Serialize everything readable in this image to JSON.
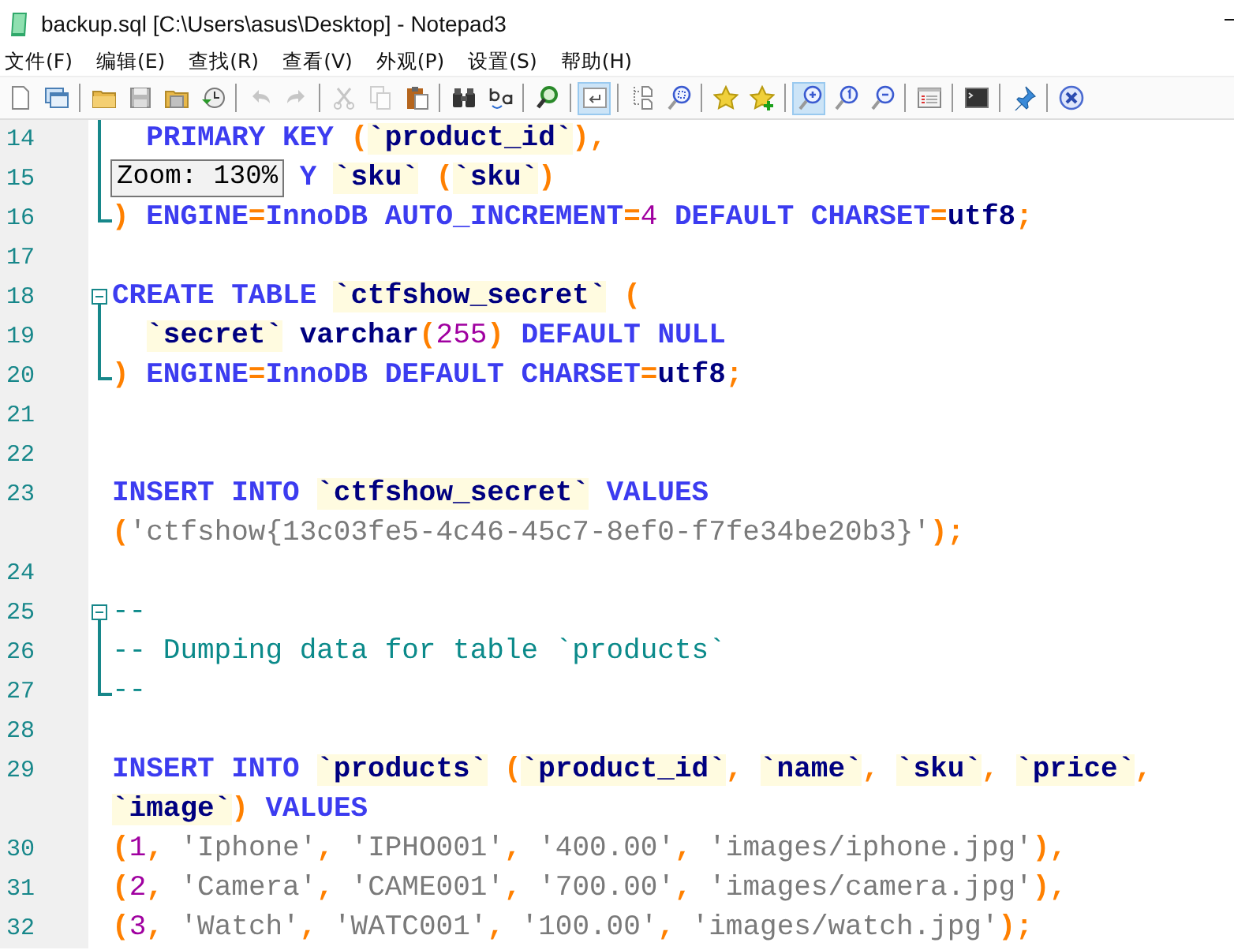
{
  "window": {
    "title": "backup.sql [C:\\Users\\asus\\Desktop] - Notepad3"
  },
  "menu": [
    "文件(F)",
    "编辑(E)",
    "查找(R)",
    "查看(V)",
    "外观(P)",
    "设置(S)",
    "帮助(H)"
  ],
  "toolbar": [
    [
      {
        "selected": false,
        "disabled": false
      },
      {
        "selected": false,
        "disabled": false
      }
    ],
    [
      {
        "selected": false,
        "disabled": false
      },
      {
        "selected": false,
        "disabled": false
      },
      {
        "selected": false,
        "disabled": false
      },
      {
        "selected": false,
        "disabled": false
      }
    ],
    [
      {
        "selected": false,
        "disabled": true
      },
      {
        "selected": false,
        "disabled": true
      }
    ],
    [
      {
        "selected": false,
        "disabled": true
      },
      {
        "selected": false,
        "disabled": true
      },
      {
        "selected": false,
        "disabled": false
      }
    ],
    [
      {
        "selected": false,
        "disabled": false
      },
      {
        "selected": false,
        "disabled": false
      }
    ],
    [
      {
        "selected": false,
        "disabled": false
      }
    ],
    [
      {
        "selected": true,
        "disabled": false
      }
    ],
    [
      {
        "selected": false,
        "disabled": false
      },
      {
        "selected": false,
        "disabled": false
      }
    ],
    [
      {
        "selected": false,
        "disabled": false
      },
      {
        "selected": false,
        "disabled": false
      }
    ],
    [
      {
        "selected": true,
        "disabled": false
      },
      {
        "selected": false,
        "disabled": false
      },
      {
        "selected": false,
        "disabled": false
      }
    ],
    [
      {
        "selected": false,
        "disabled": false
      }
    ],
    [
      {
        "selected": false,
        "disabled": false
      }
    ],
    [
      {
        "selected": false,
        "disabled": false
      }
    ],
    [
      {
        "selected": false,
        "disabled": false
      }
    ]
  ],
  "editor": {
    "zoom_tooltip": "Zoom: 130%",
    "rows": [
      {
        "number": "14",
        "marker": {
          "kind": "mid"
        },
        "indent": "  ",
        "tokens": [
          {
            "kind": "kw",
            "text": "PRIMARY KEY "
          },
          {
            "kind": "p",
            "text": "("
          },
          {
            "kind": "id",
            "text": "`product_id`"
          },
          {
            "kind": "p",
            "text": "),"
          }
        ]
      },
      {
        "number": "15",
        "marker": {
          "kind": "mid"
        },
        "indent": "           ",
        "tokens": [
          {
            "kind": "kw",
            "text": "Y "
          },
          {
            "kind": "id",
            "text": "`sku`"
          },
          {
            "kind": "p",
            "text": " ("
          },
          {
            "kind": "id",
            "text": "`sku`"
          },
          {
            "kind": "p",
            "text": ")"
          }
        ]
      },
      {
        "number": "16",
        "marker": {
          "kind": "end"
        },
        "indent": "",
        "tokens": [
          {
            "kind": "p",
            "text": ") "
          },
          {
            "kind": "kw",
            "text": "ENGINE"
          },
          {
            "kind": "p",
            "text": "="
          },
          {
            "kind": "kw",
            "text": "InnoDB AUTO_INCREMENT"
          },
          {
            "kind": "p",
            "text": "="
          },
          {
            "kind": "num",
            "text": "4"
          },
          {
            "kind": "kw",
            "text": " DEFAULT CHARSET"
          },
          {
            "kind": "p",
            "text": "="
          },
          {
            "kind": "type",
            "text": "utf8"
          },
          {
            "kind": "p",
            "text": ";"
          }
        ]
      },
      {
        "number": "17",
        "indent": "",
        "tokens": []
      },
      {
        "number": "18",
        "marker": {
          "kind": "start"
        },
        "indent": "",
        "tokens": [
          {
            "kind": "kw",
            "text": "CREATE TABLE "
          },
          {
            "kind": "id",
            "text": "`ctfshow_secret`"
          },
          {
            "kind": "p",
            "text": " ("
          }
        ]
      },
      {
        "number": "19",
        "marker": {
          "kind": "mid"
        },
        "indent": "  ",
        "tokens": [
          {
            "kind": "id",
            "text": "`secret`"
          },
          {
            "kind": "type",
            "text": " varchar"
          },
          {
            "kind": "p",
            "text": "("
          },
          {
            "kind": "num",
            "text": "255"
          },
          {
            "kind": "p",
            "text": ")"
          },
          {
            "kind": "kw",
            "text": " DEFAULT NULL"
          }
        ]
      },
      {
        "number": "20",
        "marker": {
          "kind": "end"
        },
        "indent": "",
        "tokens": [
          {
            "kind": "p",
            "text": ") "
          },
          {
            "kind": "kw",
            "text": "ENGINE"
          },
          {
            "kind": "p",
            "text": "="
          },
          {
            "kind": "kw",
            "text": "InnoDB DEFAULT CHARSET"
          },
          {
            "kind": "p",
            "text": "="
          },
          {
            "kind": "type",
            "text": "utf8"
          },
          {
            "kind": "p",
            "text": ";"
          }
        ]
      },
      {
        "number": "21",
        "indent": "",
        "tokens": []
      },
      {
        "number": "22",
        "indent": "",
        "tokens": []
      },
      {
        "number": "23",
        "indent": "",
        "tokens": [
          {
            "kind": "kw",
            "text": "INSERT INTO "
          },
          {
            "kind": "id",
            "text": "`ctfshow_secret`"
          },
          {
            "kind": "kw",
            "text": " VALUES"
          }
        ]
      },
      {
        "indent": "",
        "tokens": [
          {
            "kind": "p",
            "text": "("
          },
          {
            "kind": "str",
            "text": "'ctfshow{13c03fe5-4c46-45c7-8ef0-f7fe34be20b3}'"
          },
          {
            "kind": "p",
            "text": ");"
          }
        ]
      },
      {
        "number": "24",
        "indent": "",
        "tokens": []
      },
      {
        "number": "25",
        "marker": {
          "kind": "start"
        },
        "indent": "",
        "tokens": [
          {
            "kind": "cm",
            "text": "--"
          }
        ]
      },
      {
        "number": "26",
        "marker": {
          "kind": "mid"
        },
        "indent": "",
        "tokens": [
          {
            "kind": "cm",
            "text": "-- Dumping data for table `products`"
          }
        ]
      },
      {
        "number": "27",
        "marker": {
          "kind": "end"
        },
        "indent": "",
        "tokens": [
          {
            "kind": "cm",
            "text": "--"
          }
        ]
      },
      {
        "number": "28",
        "indent": "",
        "tokens": []
      },
      {
        "number": "29",
        "indent": "",
        "tokens": [
          {
            "kind": "kw",
            "text": "INSERT INTO "
          },
          {
            "kind": "id",
            "text": "`products`"
          },
          {
            "kind": "p",
            "text": " ("
          },
          {
            "kind": "id",
            "text": "`product_id`"
          },
          {
            "kind": "p",
            "text": ", "
          },
          {
            "kind": "id",
            "text": "`name`"
          },
          {
            "kind": "p",
            "text": ", "
          },
          {
            "kind": "id",
            "text": "`sku`"
          },
          {
            "kind": "p",
            "text": ", "
          },
          {
            "kind": "id",
            "text": "`price`"
          },
          {
            "kind": "p",
            "text": ","
          }
        ]
      },
      {
        "indent": "",
        "tokens": [
          {
            "kind": "id",
            "text": "`image`"
          },
          {
            "kind": "p",
            "text": ") "
          },
          {
            "kind": "kw",
            "text": "VALUES"
          }
        ]
      },
      {
        "number": "30",
        "indent": "",
        "tokens": [
          {
            "kind": "p",
            "text": "("
          },
          {
            "kind": "num",
            "text": "1"
          },
          {
            "kind": "p",
            "text": ", "
          },
          {
            "kind": "str",
            "text": "'Iphone'"
          },
          {
            "kind": "p",
            "text": ", "
          },
          {
            "kind": "str",
            "text": "'IPHO001'"
          },
          {
            "kind": "p",
            "text": ", "
          },
          {
            "kind": "str",
            "text": "'400.00'"
          },
          {
            "kind": "p",
            "text": ", "
          },
          {
            "kind": "str",
            "text": "'images/iphone.jpg'"
          },
          {
            "kind": "p",
            "text": "),"
          }
        ]
      },
      {
        "number": "31",
        "indent": "",
        "tokens": [
          {
            "kind": "p",
            "text": "("
          },
          {
            "kind": "num",
            "text": "2"
          },
          {
            "kind": "p",
            "text": ", "
          },
          {
            "kind": "str",
            "text": "'Camera'"
          },
          {
            "kind": "p",
            "text": ", "
          },
          {
            "kind": "str",
            "text": "'CAME001'"
          },
          {
            "kind": "p",
            "text": ", "
          },
          {
            "kind": "str",
            "text": "'700.00'"
          },
          {
            "kind": "p",
            "text": ", "
          },
          {
            "kind": "str",
            "text": "'images/camera.jpg'"
          },
          {
            "kind": "p",
            "text": "),"
          }
        ]
      },
      {
        "number": "32",
        "indent": "",
        "tokens": [
          {
            "kind": "p",
            "text": "("
          },
          {
            "kind": "num",
            "text": "3"
          },
          {
            "kind": "p",
            "text": ", "
          },
          {
            "kind": "str",
            "text": "'Watch'"
          },
          {
            "kind": "p",
            "text": ", "
          },
          {
            "kind": "str",
            "text": "'WATC001'"
          },
          {
            "kind": "p",
            "text": ", "
          },
          {
            "kind": "str",
            "text": "'100.00'"
          },
          {
            "kind": "p",
            "text": ", "
          },
          {
            "kind": "str",
            "text": "'images/watch.jpg'"
          },
          {
            "kind": "p",
            "text": ");"
          }
        ]
      }
    ]
  }
}
